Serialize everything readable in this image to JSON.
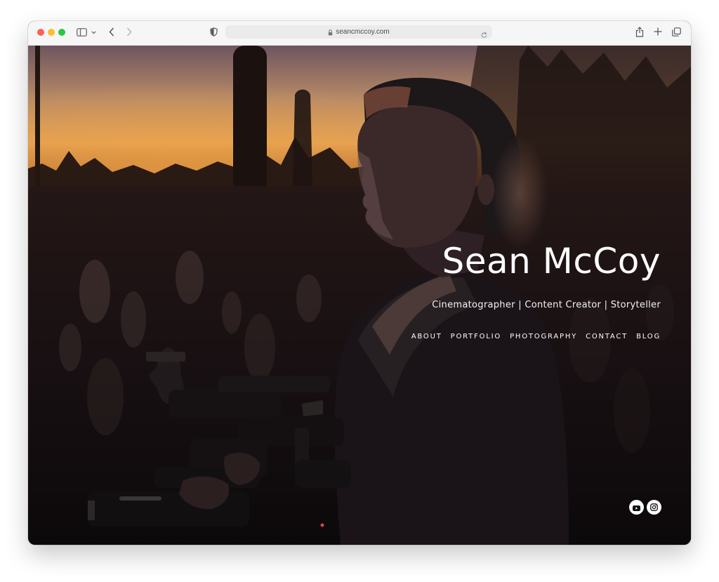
{
  "browser": {
    "url": "seancmccoy.com",
    "traffic_lights": {
      "close": "#ff5f57",
      "minimize": "#febc2e",
      "zoom": "#28c840"
    },
    "icons": [
      "sidebar-icon",
      "chevron-down-icon",
      "back-icon",
      "forward-icon",
      "shield-icon",
      "lock-icon",
      "reload-icon",
      "share-icon",
      "new-tab-icon",
      "tabs-overview-icon"
    ]
  },
  "site": {
    "name": "Sean McCoy",
    "tagline": "Cinematographer | Content Creator | Storyteller",
    "nav": [
      "ABOUT",
      "PORTFOLIO",
      "PHOTOGRAPHY",
      "CONTACT",
      "BLOG"
    ],
    "social": [
      "youtube-icon",
      "instagram-icon"
    ]
  },
  "colors": {
    "text": "#ffffff",
    "sunset": "#e79a3e",
    "dark": "#0d0a0c"
  }
}
